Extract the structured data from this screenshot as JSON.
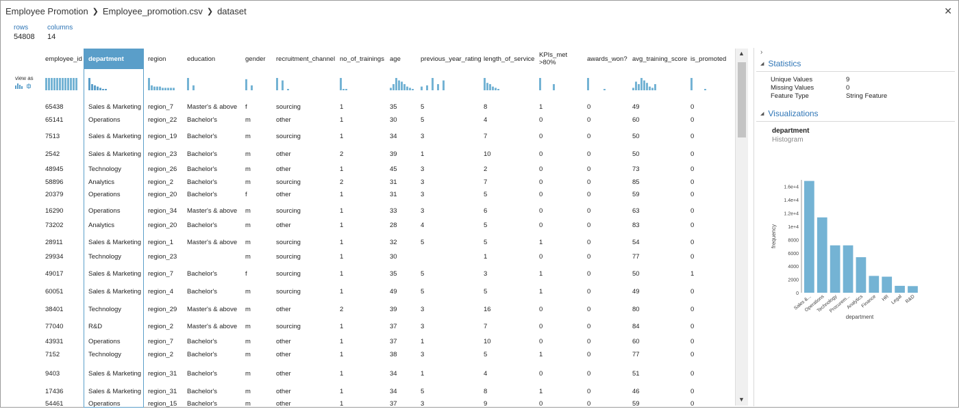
{
  "breadcrumb": {
    "items": [
      "Employee Promotion",
      "Employee_promotion.csv",
      "dataset"
    ]
  },
  "meta": {
    "rows_label": "rows",
    "rows_value": "54808",
    "columns_label": "columns",
    "columns_value": "14"
  },
  "view_as_label": "view as",
  "columns": [
    {
      "label": "employee_id"
    },
    {
      "label": "department"
    },
    {
      "label": "region"
    },
    {
      "label": "education"
    },
    {
      "label": "gender"
    },
    {
      "label": "recruitment_channel"
    },
    {
      "label": "no_of_trainings"
    },
    {
      "label": "age"
    },
    {
      "label": "previous_year_rating"
    },
    {
      "label": "length_of_service"
    },
    {
      "label": "KPIs_met >80%"
    },
    {
      "label": "awards_won?"
    },
    {
      "label": "avg_training_score"
    },
    {
      "label": "is_promoted"
    }
  ],
  "rows": [
    [
      "65438",
      "Sales & Marketing",
      "region_7",
      "Master's & above",
      "f",
      "sourcing",
      "1",
      "35",
      "5",
      "8",
      "1",
      "0",
      "49",
      "0"
    ],
    [
      "65141",
      "Operations",
      "region_22",
      "Bachelor's",
      "m",
      "other",
      "1",
      "30",
      "5",
      "4",
      "0",
      "0",
      "60",
      "0"
    ],
    [
      "7513",
      "Sales & Marketing",
      "region_19",
      "Bachelor's",
      "m",
      "sourcing",
      "1",
      "34",
      "3",
      "7",
      "0",
      "0",
      "50",
      "0"
    ],
    [
      "2542",
      "Sales & Marketing",
      "region_23",
      "Bachelor's",
      "m",
      "other",
      "2",
      "39",
      "1",
      "10",
      "0",
      "0",
      "50",
      "0"
    ],
    [
      "48945",
      "Technology",
      "region_26",
      "Bachelor's",
      "m",
      "other",
      "1",
      "45",
      "3",
      "2",
      "0",
      "0",
      "73",
      "0"
    ],
    [
      "58896",
      "Analytics",
      "region_2",
      "Bachelor's",
      "m",
      "sourcing",
      "2",
      "31",
      "3",
      "7",
      "0",
      "0",
      "85",
      "0"
    ],
    [
      "20379",
      "Operations",
      "region_20",
      "Bachelor's",
      "f",
      "other",
      "1",
      "31",
      "3",
      "5",
      "0",
      "0",
      "59",
      "0"
    ],
    [
      "16290",
      "Operations",
      "region_34",
      "Master's & above",
      "m",
      "sourcing",
      "1",
      "33",
      "3",
      "6",
      "0",
      "0",
      "63",
      "0"
    ],
    [
      "73202",
      "Analytics",
      "region_20",
      "Bachelor's",
      "m",
      "other",
      "1",
      "28",
      "4",
      "5",
      "0",
      "0",
      "83",
      "0"
    ],
    [
      "28911",
      "Sales & Marketing",
      "region_1",
      "Master's & above",
      "m",
      "sourcing",
      "1",
      "32",
      "5",
      "5",
      "1",
      "0",
      "54",
      "0"
    ],
    [
      "29934",
      "Technology",
      "region_23",
      "",
      "m",
      "sourcing",
      "1",
      "30",
      "",
      "1",
      "0",
      "0",
      "77",
      "0"
    ],
    [
      "49017",
      "Sales & Marketing",
      "region_7",
      "Bachelor's",
      "f",
      "sourcing",
      "1",
      "35",
      "5",
      "3",
      "1",
      "0",
      "50",
      "1"
    ],
    [
      "60051",
      "Sales & Marketing",
      "region_4",
      "Bachelor's",
      "m",
      "sourcing",
      "1",
      "49",
      "5",
      "5",
      "1",
      "0",
      "49",
      "0"
    ],
    [
      "38401",
      "Technology",
      "region_29",
      "Master's & above",
      "m",
      "other",
      "2",
      "39",
      "3",
      "16",
      "0",
      "0",
      "80",
      "0"
    ],
    [
      "77040",
      "R&D",
      "region_2",
      "Master's & above",
      "m",
      "sourcing",
      "1",
      "37",
      "3",
      "7",
      "0",
      "0",
      "84",
      "0"
    ],
    [
      "43931",
      "Operations",
      "region_7",
      "Bachelor's",
      "m",
      "other",
      "1",
      "37",
      "1",
      "10",
      "0",
      "0",
      "60",
      "0"
    ],
    [
      "7152",
      "Technology",
      "region_2",
      "Bachelor's",
      "m",
      "other",
      "1",
      "38",
      "3",
      "5",
      "1",
      "0",
      "77",
      "0"
    ],
    [
      "9403",
      "Sales & Marketing",
      "region_31",
      "Bachelor's",
      "m",
      "other",
      "1",
      "34",
      "1",
      "4",
      "0",
      "0",
      "51",
      "0"
    ],
    [
      "17436",
      "Sales & Marketing",
      "region_31",
      "Bachelor's",
      "m",
      "other",
      "1",
      "34",
      "5",
      "8",
      "1",
      "0",
      "46",
      "0"
    ],
    [
      "54461",
      "Operations",
      "region_15",
      "Bachelor's",
      "m",
      "other",
      "1",
      "37",
      "3",
      "9",
      "0",
      "0",
      "59",
      "0"
    ]
  ],
  "panel": {
    "statistics_title": "Statistics",
    "stats": [
      {
        "label": "Unique Values",
        "value": "9"
      },
      {
        "label": "Missing Values",
        "value": "0"
      },
      {
        "label": "Feature Type",
        "value": "String Feature"
      }
    ],
    "visualizations_title": "Visualizations",
    "viz_name": "department",
    "viz_type": "Histogram"
  },
  "chart_data": {
    "type": "bar",
    "categories": [
      "Sales &...",
      "Operations",
      "Technology",
      "Procurem...",
      "Analytics",
      "Finance",
      "HR",
      "Legal",
      "R&D"
    ],
    "values": [
      16840,
      11348,
      7138,
      7138,
      5352,
      2536,
      2418,
      1039,
      999
    ],
    "xlabel": "department",
    "ylabel": "frequency",
    "ylim": [
      0,
      17000
    ],
    "yticks": [
      0,
      2000,
      4000,
      6000,
      8000,
      10000,
      12000,
      14000,
      16000
    ],
    "ytick_labels": [
      "0",
      "2000",
      "4000",
      "6000",
      "8000",
      "1e+4",
      "1.2e+4",
      "1.4e+4",
      "1.6e+4"
    ],
    "bar_color": "#74b3d4",
    "grid": false,
    "legend": "none"
  },
  "colors": {
    "accent": "#2e75b6",
    "selected_header": "#5a9ec9",
    "histogram_bar": "#74b3d4"
  }
}
